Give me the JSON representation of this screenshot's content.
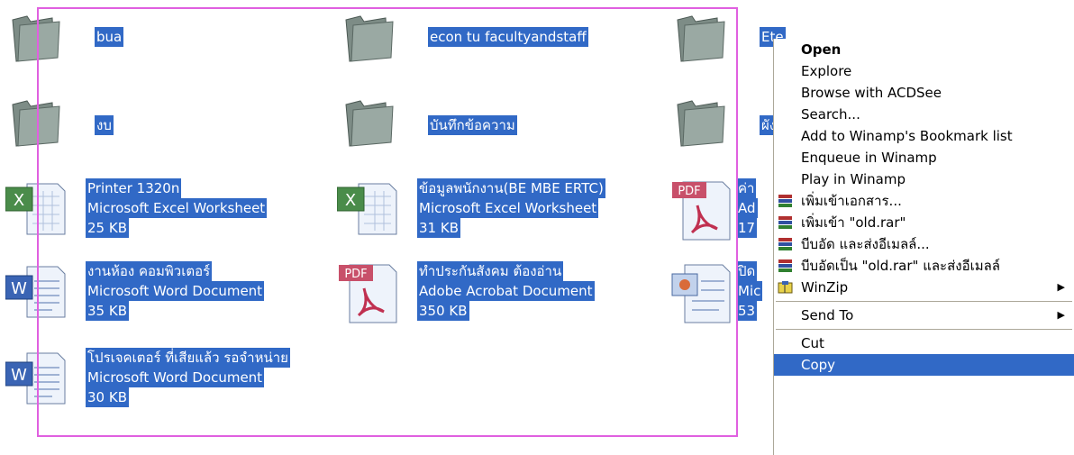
{
  "items": [
    {
      "id": "bua",
      "type": "folder",
      "lines": [
        "bua"
      ]
    },
    {
      "id": "econ",
      "type": "folder",
      "lines": [
        "econ tu facultyandstaff"
      ]
    },
    {
      "id": "ete",
      "type": "folder",
      "lines": [
        "Ete"
      ]
    },
    {
      "id": "ngob",
      "type": "folder",
      "lines": [
        "งบ"
      ]
    },
    {
      "id": "bantuek",
      "type": "folder",
      "lines": [
        "บันทึกข้อความ"
      ]
    },
    {
      "id": "phang",
      "type": "folder",
      "lines": [
        "ผัง"
      ]
    },
    {
      "id": "printer",
      "type": "excel",
      "lines": [
        "Printer 1320n",
        "Microsoft Excel Worksheet",
        "25 KB"
      ]
    },
    {
      "id": "khomul",
      "type": "excel",
      "lines": [
        "ข้อมูลพนักงาน(BE MBE ERTC)",
        "Microsoft Excel Worksheet",
        "31 KB"
      ]
    },
    {
      "id": "kha",
      "type": "pdf",
      "lines": [
        "ค่า",
        "Ad",
        "17"
      ]
    },
    {
      "id": "nganhong",
      "type": "word",
      "lines": [
        "งานห้อง คอมพิวเตอร์",
        "Microsoft Word Document",
        "35 KB"
      ]
    },
    {
      "id": "thapra",
      "type": "pdf",
      "lines": [
        "ทำประกันสังคม ต้องอ่าน",
        "Adobe Acrobat Document",
        "350 KB"
      ]
    },
    {
      "id": "pid",
      "type": "ppt",
      "lines": [
        "ปิด",
        "Mic",
        "53"
      ]
    },
    {
      "id": "projector",
      "type": "word",
      "lines": [
        "โปรเจคเตอร์ ที่เสียแล้ว รอจำหน่าย",
        "Microsoft Word Document",
        "30 KB"
      ]
    }
  ],
  "context_menu": {
    "items": [
      {
        "label": "Open",
        "bold": true
      },
      {
        "label": "Explore"
      },
      {
        "label": "Browse with ACDSee"
      },
      {
        "label": "Search..."
      },
      {
        "label": "Add to Winamp's Bookmark list"
      },
      {
        "label": "Enqueue in Winamp"
      },
      {
        "label": "Play in Winamp"
      },
      {
        "label": "เพิ่มเข้าเอกสาร...",
        "icon": "winrar-icon"
      },
      {
        "label": "เพิ่มเข้า \"old.rar\"",
        "icon": "winrar-icon"
      },
      {
        "label": "บีบอัด และส่งอีเมลล์...",
        "icon": "winrar-icon"
      },
      {
        "label": "บีบอัดเป็น \"old.rar\" และส่งอีเมลล์",
        "icon": "winrar-icon"
      },
      {
        "label": "WinZip",
        "icon": "winzip-icon",
        "submenu": true
      },
      {
        "separator": true
      },
      {
        "label": "Send To",
        "submenu": true
      },
      {
        "separator": true
      },
      {
        "label": "Cut"
      },
      {
        "label": "Copy",
        "highlighted": true
      }
    ]
  },
  "colors": {
    "selection": "#3169c6",
    "marquee": "#e060e0",
    "menu_highlight": "#3169c6"
  }
}
